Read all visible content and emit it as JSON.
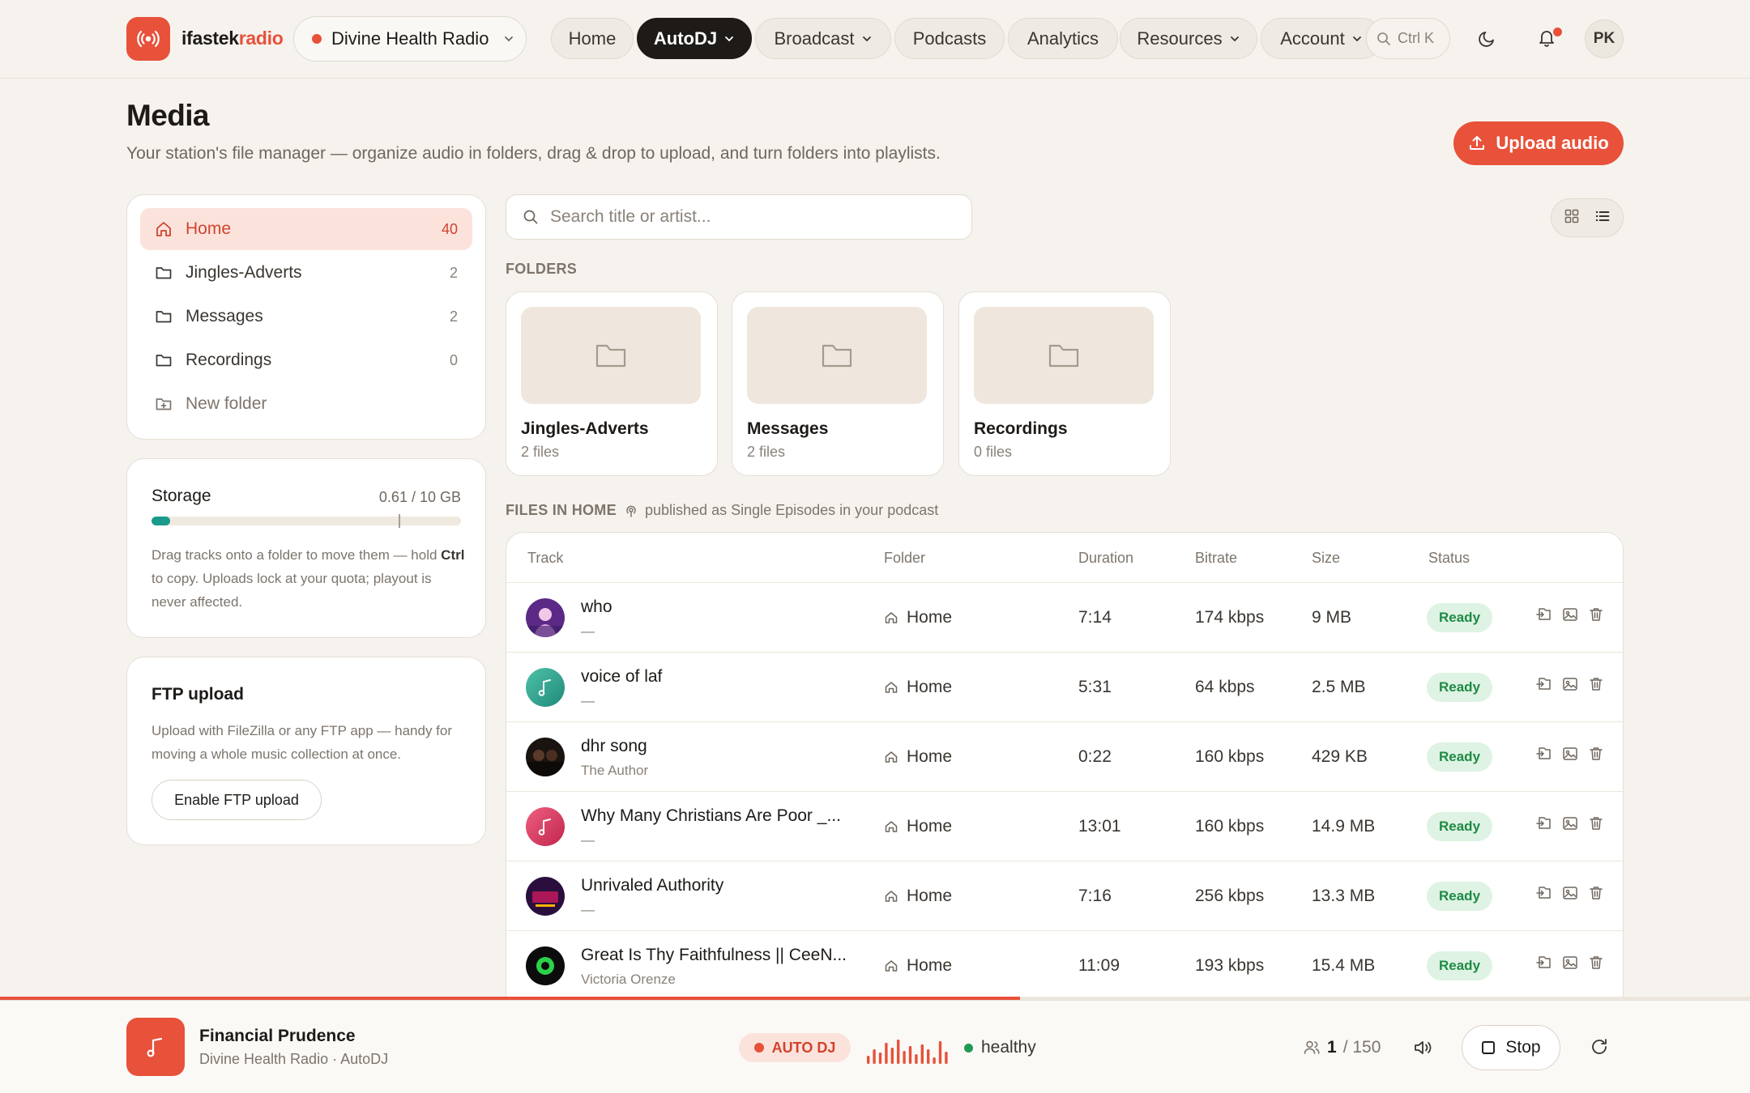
{
  "brand": {
    "name_prefix": "ifastek",
    "name_suffix": "radio",
    "accent": "#e8513a"
  },
  "station": {
    "name": "Divine Health Radio"
  },
  "nav": {
    "items": [
      {
        "label": "Home",
        "active": false
      },
      {
        "label": "AutoDJ",
        "active": true,
        "dropdown": true
      },
      {
        "label": "Broadcast",
        "active": false,
        "dropdown": true
      },
      {
        "label": "Podcasts",
        "active": false
      },
      {
        "label": "Analytics",
        "active": false
      },
      {
        "label": "Resources",
        "active": false,
        "dropdown": true
      },
      {
        "label": "Account",
        "active": false,
        "dropdown": true
      }
    ],
    "search_shortcut": "Ctrl K",
    "avatar_initials": "PK"
  },
  "page": {
    "title": "Media",
    "subtitle": "Your station's file manager — organize audio in folders, drag & drop to upload, and turn folders into playlists.",
    "upload_label": "Upload audio"
  },
  "sidebar": {
    "items": [
      {
        "label": "Home",
        "count": "40",
        "icon": "home-icon"
      },
      {
        "label": "Jingles-Adverts",
        "count": "2",
        "icon": "folder-icon"
      },
      {
        "label": "Messages",
        "count": "2",
        "icon": "folder-icon"
      },
      {
        "label": "Recordings",
        "count": "0",
        "icon": "folder-icon"
      }
    ],
    "new_folder_label": "New folder"
  },
  "storage": {
    "title": "Storage",
    "value": "0.61 / 10 GB",
    "used_fraction": 0.061,
    "note_before": "Drag tracks onto a folder to move them — hold ",
    "note_key": "Ctrl",
    "note_after": " to copy. Uploads lock at your quota; playout is never affected."
  },
  "ftp": {
    "title": "FTP upload",
    "note": "Upload with FileZilla or any FTP app — handy for moving a whole music collection at once.",
    "button_label": "Enable FTP upload"
  },
  "search": {
    "placeholder": "Search title or artist..."
  },
  "folders_section": {
    "label": "FOLDERS",
    "folders": [
      {
        "name": "Jingles-Adverts",
        "files": "2 files"
      },
      {
        "name": "Messages",
        "files": "2 files"
      },
      {
        "name": "Recordings",
        "files": "0 files"
      }
    ]
  },
  "files_section": {
    "label": "FILES IN HOME",
    "podcast_note": "published as Single Episodes in your podcast"
  },
  "table": {
    "headers": {
      "track": "Track",
      "folder": "Folder",
      "duration": "Duration",
      "bitrate": "Bitrate",
      "size": "Size",
      "status": "Status"
    },
    "rows": [
      {
        "title": "who",
        "artist": "—",
        "folder": "Home",
        "duration": "7:14",
        "bitrate": "174 kbps",
        "size": "9 MB",
        "status": "Ready",
        "cover": "photo-purple"
      },
      {
        "title": "voice of laf",
        "artist": "—",
        "folder": "Home",
        "duration": "5:31",
        "bitrate": "64 kbps",
        "size": "2.5 MB",
        "status": "Ready",
        "cover": "note-teal"
      },
      {
        "title": "dhr song",
        "artist": "The Author",
        "folder": "Home",
        "duration": "0:22",
        "bitrate": "160 kbps",
        "size": "429 KB",
        "status": "Ready",
        "cover": "photo-dark"
      },
      {
        "title": "Why Many Christians Are Poor _...",
        "artist": "—",
        "folder": "Home",
        "duration": "13:01",
        "bitrate": "160 kbps",
        "size": "14.9 MB",
        "status": "Ready",
        "cover": "note-pink"
      },
      {
        "title": "Unrivaled Authority",
        "artist": "—",
        "folder": "Home",
        "duration": "7:16",
        "bitrate": "256 kbps",
        "size": "13.3 MB",
        "status": "Ready",
        "cover": "photo-night"
      },
      {
        "title": "Great Is Thy Faithfulness || CeeN...",
        "artist": "Victoria Orenze",
        "folder": "Home",
        "duration": "11:09",
        "bitrate": "193 kbps",
        "size": "15.4 MB",
        "status": "Ready",
        "cover": "photo-green"
      }
    ]
  },
  "player": {
    "title": "Financial Prudence",
    "subtitle": "Divine Health Radio · AutoDJ",
    "mode_label": "AUTO DJ",
    "health_label": "healthy",
    "listeners_current": "1",
    "listeners_max": "/ 150",
    "stop_label": "Stop",
    "progress_fraction": 0.583
  }
}
